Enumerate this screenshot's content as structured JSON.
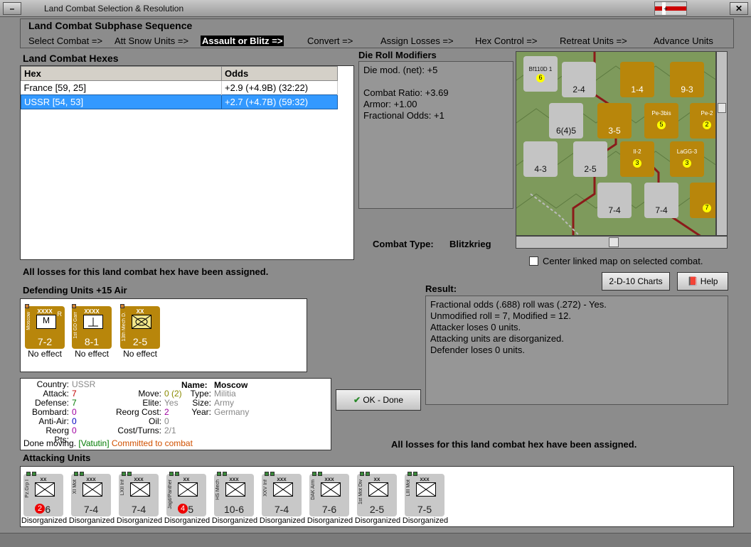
{
  "window": {
    "title": "Land Combat Selection & Resolution"
  },
  "subphase": {
    "title": "Land Combat Subphase Sequence",
    "steps": [
      "Select Combat =>",
      "Att Snow Units =>",
      "Assault or Blitz =>",
      "Convert =>",
      "Assign Losses =>",
      "Hex Control =>",
      "Retreat Units =>",
      "Advance Units"
    ],
    "active_index": 2
  },
  "hexes": {
    "title": "Land Combat Hexes",
    "headers": [
      "Hex",
      "Odds"
    ],
    "rows": [
      {
        "hex": "France [59, 25]",
        "odds": "+2.9 (+4.9B) (32:22)"
      },
      {
        "hex": "USSR [54, 53]",
        "odds": "+2.7 (+4.7B) (59:32)"
      }
    ],
    "selected_index": 1
  },
  "modifiers": {
    "title": "Die Roll Modifiers",
    "lines": [
      "Die mod. (net): +5",
      "",
      "Combat Ratio: +3.69",
      "Armor: +1.00",
      "Fractional Odds: +1"
    ]
  },
  "combat_type": {
    "label": "Combat Type:",
    "value": "Blitzkrieg"
  },
  "map": {
    "center_label": "Center linked map on selected combat.",
    "counters": [
      {
        "name": "Bf110D 1",
        "value": "6"
      },
      {
        "name": "2-4"
      },
      {
        "name": "1-4"
      },
      {
        "name": "9-3"
      },
      {
        "name": "6(4)5"
      },
      {
        "name": "3-5"
      },
      {
        "name": "Pe-3bis",
        "value": "5"
      },
      {
        "name": "Pe-2",
        "value": "2"
      },
      {
        "name": "4-3"
      },
      {
        "name": "2-5"
      },
      {
        "name": "Il-2",
        "value": "3"
      },
      {
        "name": "LaGG-3",
        "value": "3"
      },
      {
        "name": "7-4"
      },
      {
        "name": "7-4"
      },
      {
        "name": "7"
      }
    ]
  },
  "losses_assigned": "All losses for this land combat hex have been assigned.",
  "defending": {
    "title": "Defending Units +15 Air",
    "units": [
      {
        "size": "XXXX",
        "name": "Moscow",
        "strength": "7-2",
        "status": "No effect",
        "badge": "R"
      },
      {
        "size": "XXXX",
        "name": "1st GD Garr",
        "strength": "8-1",
        "status": "No effect"
      },
      {
        "size": "XX",
        "name": "13th Mech D.",
        "strength": "2-5",
        "status": "No effect"
      }
    ]
  },
  "buttons": {
    "charts": "2-D-10 Charts",
    "help": "Help",
    "ok": "OK - Done"
  },
  "result": {
    "title": "Result:",
    "lines": [
      "Fractional odds (.688) roll was (.272)  - Yes.",
      "Unmodified roll = 7, Modified = 12.",
      "Attacker loses 0 units.",
      "Attacking units are disorganized.",
      "Defender loses 0 units."
    ]
  },
  "unit_info": {
    "country_label": "Country:",
    "country": "USSR",
    "attack_label": "Attack:",
    "attack": "7",
    "defense_label": "Defense:",
    "defense": "7",
    "bombard_label": "Bombard:",
    "bombard": "0",
    "antiair_label": "Anti-Air:",
    "antiair": "0",
    "reorg_pts_label": "Reorg Pts:",
    "reorg_pts": "0",
    "name_label": "Name:",
    "name": "Moscow",
    "move_label": "Move:",
    "move": "0 (2)",
    "type_label": "Type:",
    "type": "Militia",
    "elite_label": "Elite:",
    "elite": "Yes",
    "size_label": "Size:",
    "size": "Army",
    "reorg_cost_label": "Reorg Cost:",
    "reorg_cost": "2",
    "year_label": "Year:",
    "year": "Germany",
    "oil_label": "Oil:",
    "oil": "0",
    "cost_label": "Cost/Turns:",
    "cost": "2/1",
    "done_moving": "Done moving.",
    "leader": "[Vatutin]",
    "committed": "Committed to combat"
  },
  "losses_assigned_bottom": "All losses for this land combat hex have been assigned.",
  "attacking": {
    "title": "Attacking Units",
    "units": [
      {
        "size": "xx",
        "name": "Pz.Grp I",
        "strength": "2-6",
        "status": "Disorganized",
        "marker": "2"
      },
      {
        "size": "xxx",
        "name": "XI Mot",
        "strength": "7-4",
        "status": "Disorganized"
      },
      {
        "size": "xxx",
        "name": "LXII Inf",
        "strength": "7-4",
        "status": "Disorganized"
      },
      {
        "size": "xx",
        "name": "Jagd/Panther",
        "strength": "4-5",
        "status": "Disorganized",
        "marker": "4"
      },
      {
        "size": "xxx",
        "name": "HS Mech",
        "strength": "10-6",
        "status": "Disorganized"
      },
      {
        "size": "xxx",
        "name": "XXV Inf",
        "strength": "7-4",
        "status": "Disorganized"
      },
      {
        "size": "xxx",
        "name": "DAK Arm",
        "strength": "7-6",
        "status": "Disorganized"
      },
      {
        "size": "xx",
        "name": "1st Mot Div",
        "strength": "2-5",
        "status": "Disorganized"
      },
      {
        "size": "xxx",
        "name": "LIII Mot",
        "strength": "7-5",
        "status": "Disorganized"
      }
    ]
  }
}
